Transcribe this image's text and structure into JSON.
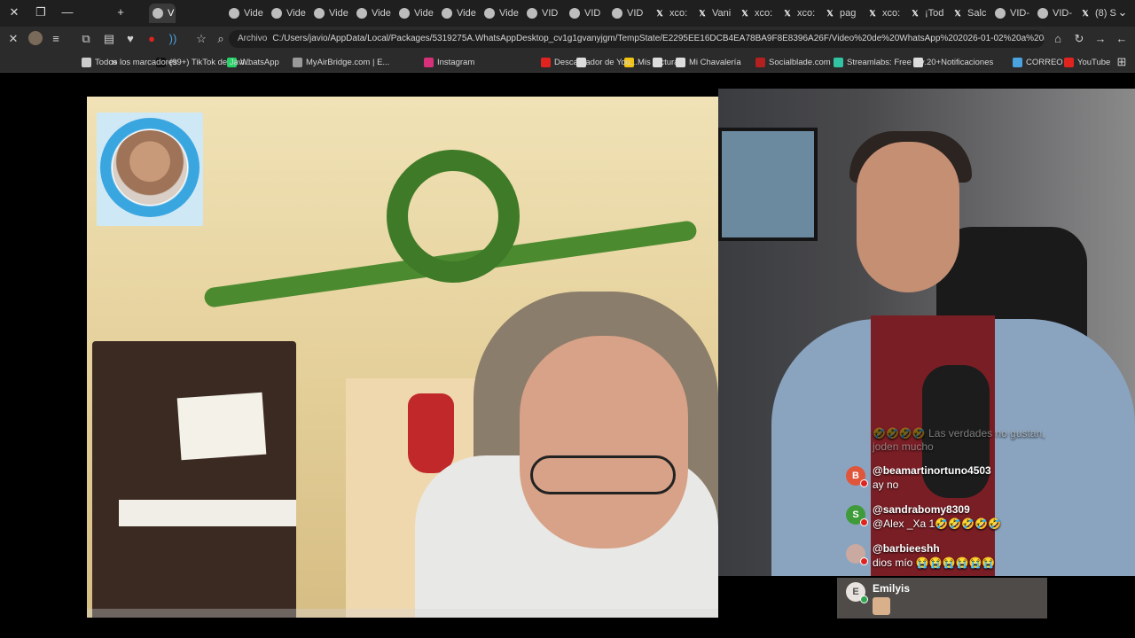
{
  "tabs": [
    {
      "label": "(8) S",
      "favicon": "x",
      "active": false
    },
    {
      "label": "VID-",
      "favicon": "circle",
      "active": false
    },
    {
      "label": "VID-",
      "favicon": "circle",
      "active": false
    },
    {
      "label": "Salc",
      "favicon": "x",
      "active": false
    },
    {
      "label": "¡Tod",
      "favicon": "x",
      "active": false
    },
    {
      "label": "xco:",
      "favicon": "x",
      "active": false
    },
    {
      "label": "pag",
      "favicon": "x",
      "active": false
    },
    {
      "label": "xco:",
      "favicon": "x",
      "active": false
    },
    {
      "label": "xco:",
      "favicon": "x",
      "active": false
    },
    {
      "label": "Vani",
      "favicon": "x",
      "active": false
    },
    {
      "label": "xco:",
      "favicon": "x",
      "active": false
    },
    {
      "label": "VID",
      "favicon": "circle",
      "active": false
    },
    {
      "label": "VID",
      "favicon": "circle",
      "active": false
    },
    {
      "label": "VID",
      "favicon": "circle",
      "active": false
    },
    {
      "label": "Vide",
      "favicon": "circle",
      "active": false
    },
    {
      "label": "Vide",
      "favicon": "circle",
      "active": false
    },
    {
      "label": "Vide",
      "favicon": "circle",
      "active": false
    },
    {
      "label": "Vide",
      "favicon": "circle",
      "active": false
    },
    {
      "label": "Vide",
      "favicon": "circle",
      "active": false
    },
    {
      "label": "Vide",
      "favicon": "circle",
      "active": false
    },
    {
      "label": "Vide",
      "favicon": "circle",
      "active": false
    },
    {
      "label": "V",
      "favicon": "circle",
      "active": true
    }
  ],
  "window": {
    "close": "✕",
    "restore": "❐",
    "minimize": "—",
    "new_tab": "+",
    "tab_search": "⌄"
  },
  "toolbar": {
    "url_scheme": "Archivo",
    "url": "C:/Users/javio/AppData/Local/Packages/5319275A.WhatsAppDesktop_cv1g1gvanyjgm/TempState/E2295EE16DCB4EA78BA9F8E8396A26F/Video%20de%20WhatsApp%202026-01-02%20a%20las%2017.33....",
    "back_icon": "←",
    "forward_icon": "→",
    "reload_icon": "↻",
    "home_icon": "⌂"
  },
  "bookmarks": [
    {
      "label": "YouTube",
      "color": "#e0231f"
    },
    {
      "label": "CORREO",
      "color": "#4aa3df"
    },
    {
      "label": "20+Notificaciones",
      "color": "#dddddd"
    },
    {
      "label": "Streamlabs: Free Liv...",
      "color": "#31c3a2"
    },
    {
      "label": "Socialblade.com",
      "color": "#b2201f"
    },
    {
      "label": "Mi Chavalería",
      "color": "#dddddd"
    },
    {
      "label": "",
      "color": "#dddddd"
    },
    {
      "label": "Mis facturas",
      "color": "#f2c311"
    },
    {
      "label": "",
      "color": "#dddddd"
    },
    {
      "label": "Descargador de You...",
      "color": "#e0231f"
    },
    {
      "label": "Instagram",
      "color": "#d6307a"
    },
    {
      "label": "MyAirBridge.com | E...",
      "color": "#999999"
    },
    {
      "label": "WhatsApp",
      "color": "#25d366"
    },
    {
      "label": "(99+) TikTok de Javi...",
      "color": "#111111"
    },
    {
      "label": "Todos los marcadores",
      "color": "#cccccc"
    }
  ],
  "chat": [
    {
      "user": "",
      "text": "🤣🤣🤣🤣 Las verdades no gustan, joden mucho",
      "avatar_letter": "",
      "avatar_color": "#666666",
      "faded": true
    },
    {
      "user": "@beamartinortuno4503",
      "text": "ay no",
      "avatar_letter": "B",
      "avatar_color": "#e0563b",
      "faded": false
    },
    {
      "user": "@sandrabomy8309",
      "text": "@Alex _Xa 1🤣🤣🤣🤣🤣",
      "avatar_letter": "S",
      "avatar_color": "#3f9b3a",
      "faded": false
    },
    {
      "user": "@barbieeshh",
      "text": "dios mío 😭😭😭😭😭😭",
      "avatar_letter": "",
      "avatar_color": "#c9a9a0",
      "faded": false
    }
  ],
  "last_message": {
    "user": "Emilyis",
    "avatar_letter": "E"
  }
}
